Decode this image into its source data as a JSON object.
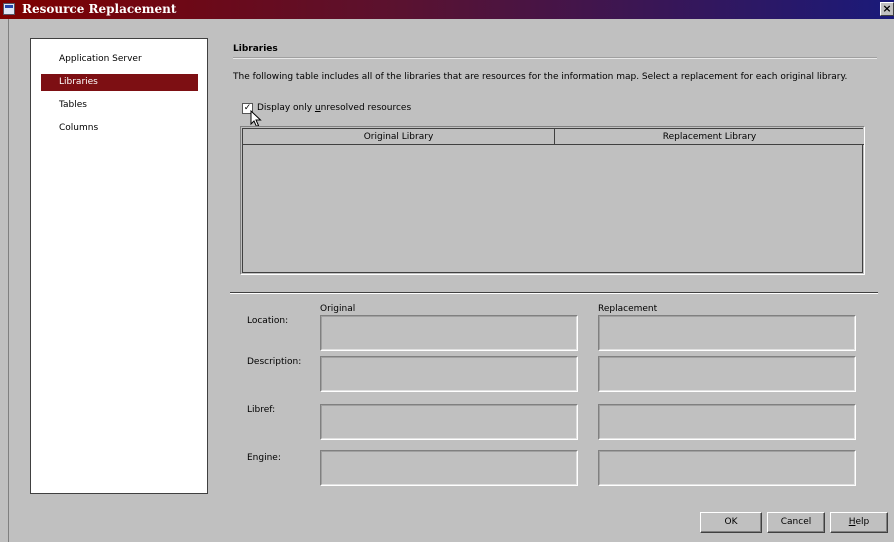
{
  "window": {
    "title": "Resource Replacement",
    "close_glyph": "×"
  },
  "nav": {
    "items": [
      {
        "label": "Application Server",
        "selected": false
      },
      {
        "label": "Libraries",
        "selected": true
      },
      {
        "label": "Tables",
        "selected": false
      },
      {
        "label": "Columns",
        "selected": false
      }
    ]
  },
  "section": {
    "title": "Libraries",
    "description": "The following table includes all of the libraries that are resources for the information map.  Select a replacement for each original library."
  },
  "filter": {
    "label_before": "Display only ",
    "label_mnemonic": "u",
    "label_after": "nresolved resources",
    "checked": true,
    "check_glyph": "✓"
  },
  "table": {
    "columns": [
      "Original Library",
      "Replacement Library"
    ],
    "rows": []
  },
  "details": {
    "original_heading": "Original",
    "replacement_heading": "Replacement",
    "fields": [
      {
        "label": "Location:",
        "original": "",
        "replacement": ""
      },
      {
        "label": "Description:",
        "original": "",
        "replacement": ""
      },
      {
        "label": "Libref:",
        "original": "",
        "replacement": ""
      },
      {
        "label": "Engine:",
        "original": "",
        "replacement": ""
      }
    ]
  },
  "buttons": {
    "ok": "OK",
    "cancel": "Cancel",
    "help_mnemonic": "H",
    "help_rest": "elp"
  },
  "colors": {
    "title_start": "#7e0000",
    "title_end": "#1a1a7a",
    "selection": "#7d0f13",
    "dialog_bg": "#c0c0c0"
  }
}
